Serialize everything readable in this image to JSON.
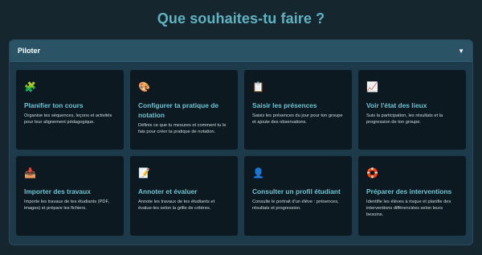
{
  "page": {
    "title": "Que souhaites-tu faire ?"
  },
  "panel": {
    "title": "Piloter",
    "toggle_icon": "▼"
  },
  "cards": [
    {
      "icon": "🧩",
      "icon_name": "puzzle-icon",
      "title": "Planifier ton cours",
      "desc": "Organise tes séquences, leçons et activités pour leur alignement pédagogique."
    },
    {
      "icon": "🎨",
      "icon_name": "palette-icon",
      "title": "Configurer ta pratique de notation",
      "desc": "Définis ce que tu mesures et comment tu le fais pour créer ta pratique de notation."
    },
    {
      "icon": "📋",
      "icon_name": "clipboard-icon",
      "title": "Saisir les présences",
      "desc": "Saisis les présences du jour pour ton groupe et ajoute des observations."
    },
    {
      "icon": "📈",
      "icon_name": "chart-icon",
      "title": "Voir l'état des lieux",
      "desc": "Suis la participation, les résultats et la progression de ton groupe."
    },
    {
      "icon": "📥",
      "icon_name": "inbox-tray-icon",
      "title": "Importer des travaux",
      "desc": "Importe les travaux de tes étudiants (PDF, images) et prépare les fichiers."
    },
    {
      "icon": "📝",
      "icon_name": "memo-icon",
      "title": "Annoter et évaluer",
      "desc": "Annote les travaux de tes étudiants et évalue-les selon la grille de critères."
    },
    {
      "icon": "👤",
      "icon_name": "user-silhouette-icon",
      "title": "Consulter un profil étudiant",
      "desc": "Consulte le portrait d'un élève : présences, résultats et progression."
    },
    {
      "icon": "🛟",
      "icon_name": "lifebuoy-icon",
      "title": "Préparer des interventions",
      "desc": "Identifie les élèves à risque et planifie des interventions différenciées selon leurs besoins."
    }
  ],
  "colors": {
    "background": "#16262e",
    "title": "#5fb3c1",
    "panel": "#1d3a4b",
    "panel_header": "#2a5366",
    "card": "#0c1920",
    "card_title": "#6cc3d2",
    "card_text": "#d3dde2"
  }
}
